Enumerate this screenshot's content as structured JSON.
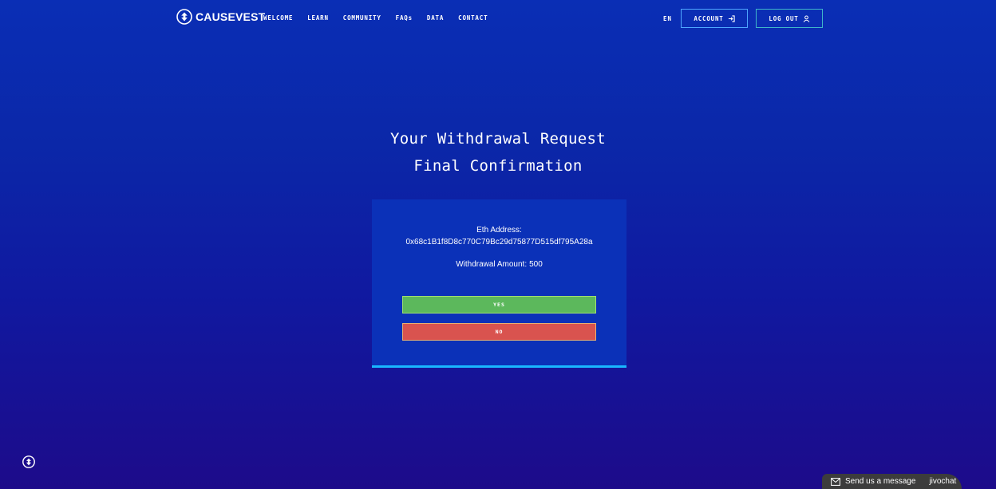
{
  "header": {
    "logo_text": "CAUSEVEST",
    "nav": [
      "WELCOME",
      "LEARN",
      "COMMUNITY",
      "FAQs",
      "DATA",
      "CONTACT"
    ],
    "lang": "EN",
    "account_label": "ACCOUNT",
    "logout_label": "LOG OUT"
  },
  "title": {
    "line1": "Your Withdrawal Request",
    "line2": "Final Confirmation"
  },
  "confirmation": {
    "eth_label": "Eth Address:",
    "eth_address": "0x68c1B1f8D8c770C79Bc29d75877D515df795A28a",
    "amount_label": "Withdrawal Amount:",
    "amount_value": "500",
    "yes_label": "YES",
    "no_label": "NO"
  },
  "chat": {
    "send_label": "Send us a message",
    "brand": "jivochat"
  },
  "colors": {
    "yes": "#5cb85c",
    "no": "#d9534f",
    "card": "#0b31b8",
    "accent": "#19b7ff"
  }
}
